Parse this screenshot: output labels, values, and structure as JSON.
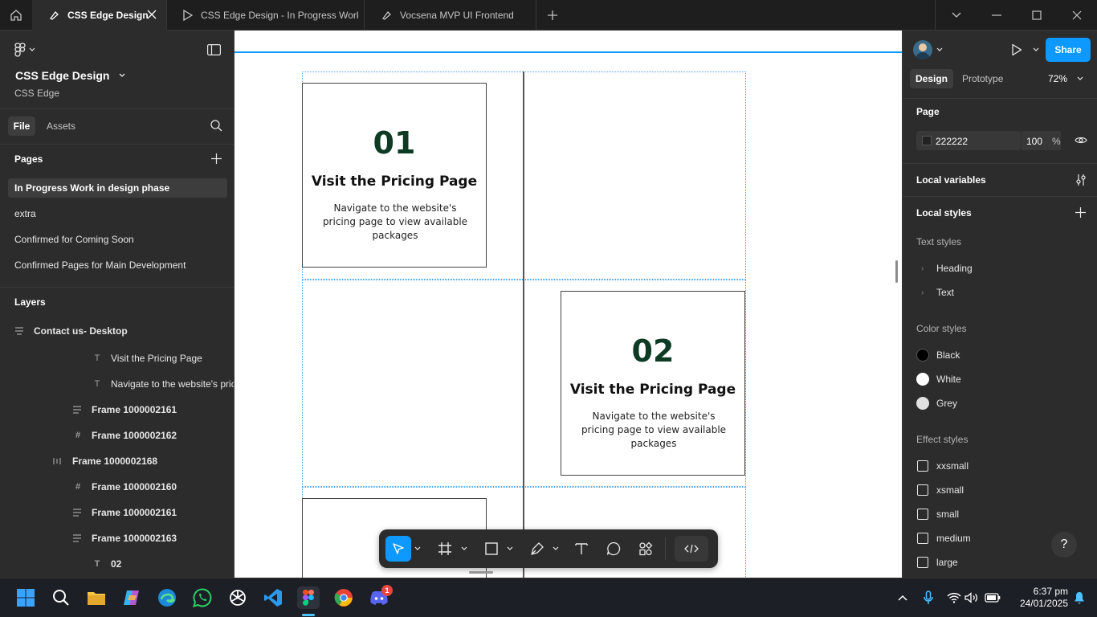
{
  "titlebar": {
    "tabs": [
      {
        "label": "CSS Edge Design",
        "active": true
      },
      {
        "label": "CSS Edge Design - In Progress Work i",
        "active": false
      },
      {
        "label": "Vocsena MVP UI Frontend",
        "active": false
      }
    ]
  },
  "left_panel": {
    "project_title": "CSS Edge Design",
    "team_name": "CSS Edge",
    "tabs": {
      "file": "File",
      "assets": "Assets"
    },
    "pages_heading": "Pages",
    "pages": [
      "In Progress Work in design phase",
      "extra",
      "Confirmed for Coming Soon",
      "Confirmed Pages for Main Development"
    ],
    "layers_heading": "Layers",
    "layers": [
      {
        "label": "Contact us- Desktop",
        "icon": "frame-autolayout-icon"
      },
      {
        "label": "Visit the Pricing Page",
        "icon": "text-icon"
      },
      {
        "label": "Navigate to the website's pricing page",
        "icon": "text-icon"
      },
      {
        "label": "Frame 1000002161",
        "icon": "autolayout-icon"
      },
      {
        "label": "Frame 1000002162",
        "icon": "frame-icon"
      },
      {
        "label": "Frame 1000002168",
        "icon": "horizontal-autolayout-icon"
      },
      {
        "label": "Frame 1000002160",
        "icon": "frame-icon"
      },
      {
        "label": "Frame 1000002161",
        "icon": "autolayout-icon"
      },
      {
        "label": "Frame 1000002163",
        "icon": "autolayout-icon"
      },
      {
        "label": "02",
        "icon": "text-icon"
      }
    ]
  },
  "canvas": {
    "cards": [
      {
        "number": "01",
        "title": "Visit the Pricing Page",
        "description": "Navigate to the website's pricing page to view available packages"
      },
      {
        "number": "02",
        "title": "Visit the Pricing Page",
        "description": "Navigate to the website's pricing page to view available packages"
      }
    ]
  },
  "right_panel": {
    "share_label": "Share",
    "tabs": {
      "design": "Design",
      "prototype": "Prototype"
    },
    "zoom": "72%",
    "page_heading": "Page",
    "page_color_hex": "222222",
    "page_opacity": "100",
    "percent_sign": "%",
    "local_variables": "Local variables",
    "local_styles": "Local styles",
    "text_styles_heading": "Text styles",
    "text_styles": [
      "Heading",
      "Text"
    ],
    "color_styles_heading": "Color styles",
    "color_styles": [
      {
        "name": "Black",
        "color": "#000000"
      },
      {
        "name": "White",
        "color": "#ffffff"
      },
      {
        "name": "Grey",
        "color": "#e0e0e0"
      }
    ],
    "effect_styles_heading": "Effect styles",
    "effect_styles": [
      "xxsmall",
      "xsmall",
      "small",
      "medium",
      "large"
    ],
    "help_label": "?"
  },
  "taskbar": {
    "time": "6:37 pm",
    "date": "24/01/2025",
    "discord_badge": "1"
  },
  "colors": {
    "accent": "#0d99ff",
    "card_number": "#0d3b24"
  }
}
